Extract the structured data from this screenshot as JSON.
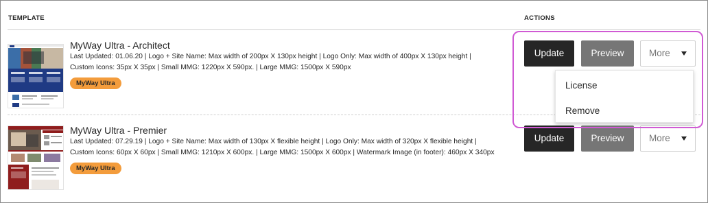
{
  "table": {
    "headers": {
      "template": "TEMPLATE",
      "actions": "ACTIONS"
    },
    "rows": [
      {
        "title": "MyWay Ultra - Architect",
        "desc_line1": "Last Updated: 01.06.20 | Logo + Site Name: Max width of 200px X 130px height | Logo Only: Max width of 400px X 130px height |",
        "desc_line2": "Custom Icons: 35px X 35px | Small MMG: 1220px X 590px. | Large MMG: 1500px X 590px",
        "badge": "MyWay Ultra",
        "actions": {
          "update": "Update",
          "preview": "Preview",
          "more": "More"
        }
      },
      {
        "title": "MyWay Ultra - Premier",
        "desc_line1": "Last Updated: 07.29.19 | Logo + Site Name: Max width of 130px X flexible height | Logo Only: Max width of 320px X flexible height |",
        "desc_line2": "Custom Icons: 60px X 60px | Small MMG: 1210px X 600px. | Large MMG: 1500px X 600px | Watermark Image (in footer): 460px X 340px",
        "badge": "MyWay Ultra",
        "actions": {
          "update": "Update",
          "preview": "Preview",
          "more": "More"
        }
      }
    ]
  },
  "more_menu": {
    "items": [
      "License",
      "Remove"
    ]
  },
  "colors": {
    "badge": "#f39c3c",
    "update_button": "#262626",
    "preview_button": "#767676",
    "highlight": "#d05ad4",
    "thumb_architect_primary": "#1f3a84",
    "thumb_premier_primary": "#8f1d1d"
  },
  "icons": {
    "more_dropdown": "caret-down-icon"
  }
}
